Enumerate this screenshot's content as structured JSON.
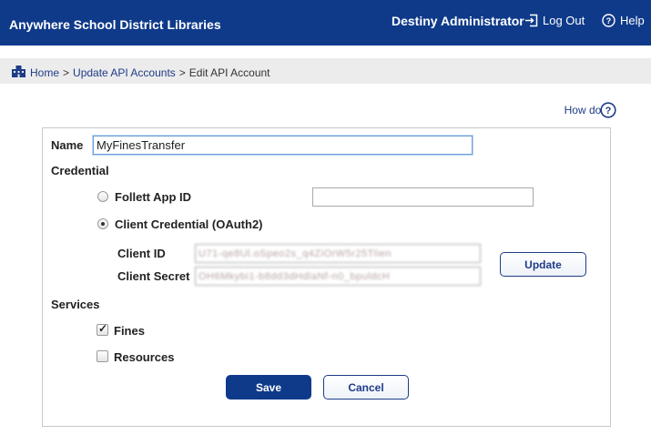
{
  "header": {
    "app_title": "Anywhere School District Libraries",
    "user_name": "Destiny Administrator",
    "logout_label": "Log Out",
    "help_label": "Help",
    "bg_color": "#0f3a8a"
  },
  "breadcrumb": {
    "home": "Home",
    "update_api": "Update API Accounts",
    "current": "Edit API Account",
    "separator": ">"
  },
  "how_do_i": "How do I...",
  "form": {
    "name_label": "Name",
    "name_value": "MyFinesTransfer",
    "credential_label": "Credential",
    "follett_label": "Follett App ID",
    "follett_value": "",
    "oauth_label": "Client Credential (OAuth2)",
    "selected_credential": "oauth",
    "client_id_label": "Client ID",
    "client_id_value": "U71-qe8Ul.oSpeo2s_q4ZiOrW5r25Tlien",
    "client_secret_label": "Client Secret",
    "client_secret_value": "OH6Mkybi1-b8dd3dHdlaNf-n0_bpuldcH",
    "update_label": "Update",
    "services_label": "Services",
    "fines_label": "Fines",
    "fines_checked": true,
    "resources_label": "Resources",
    "resources_checked": false,
    "save_label": "Save",
    "cancel_label": "Cancel"
  }
}
